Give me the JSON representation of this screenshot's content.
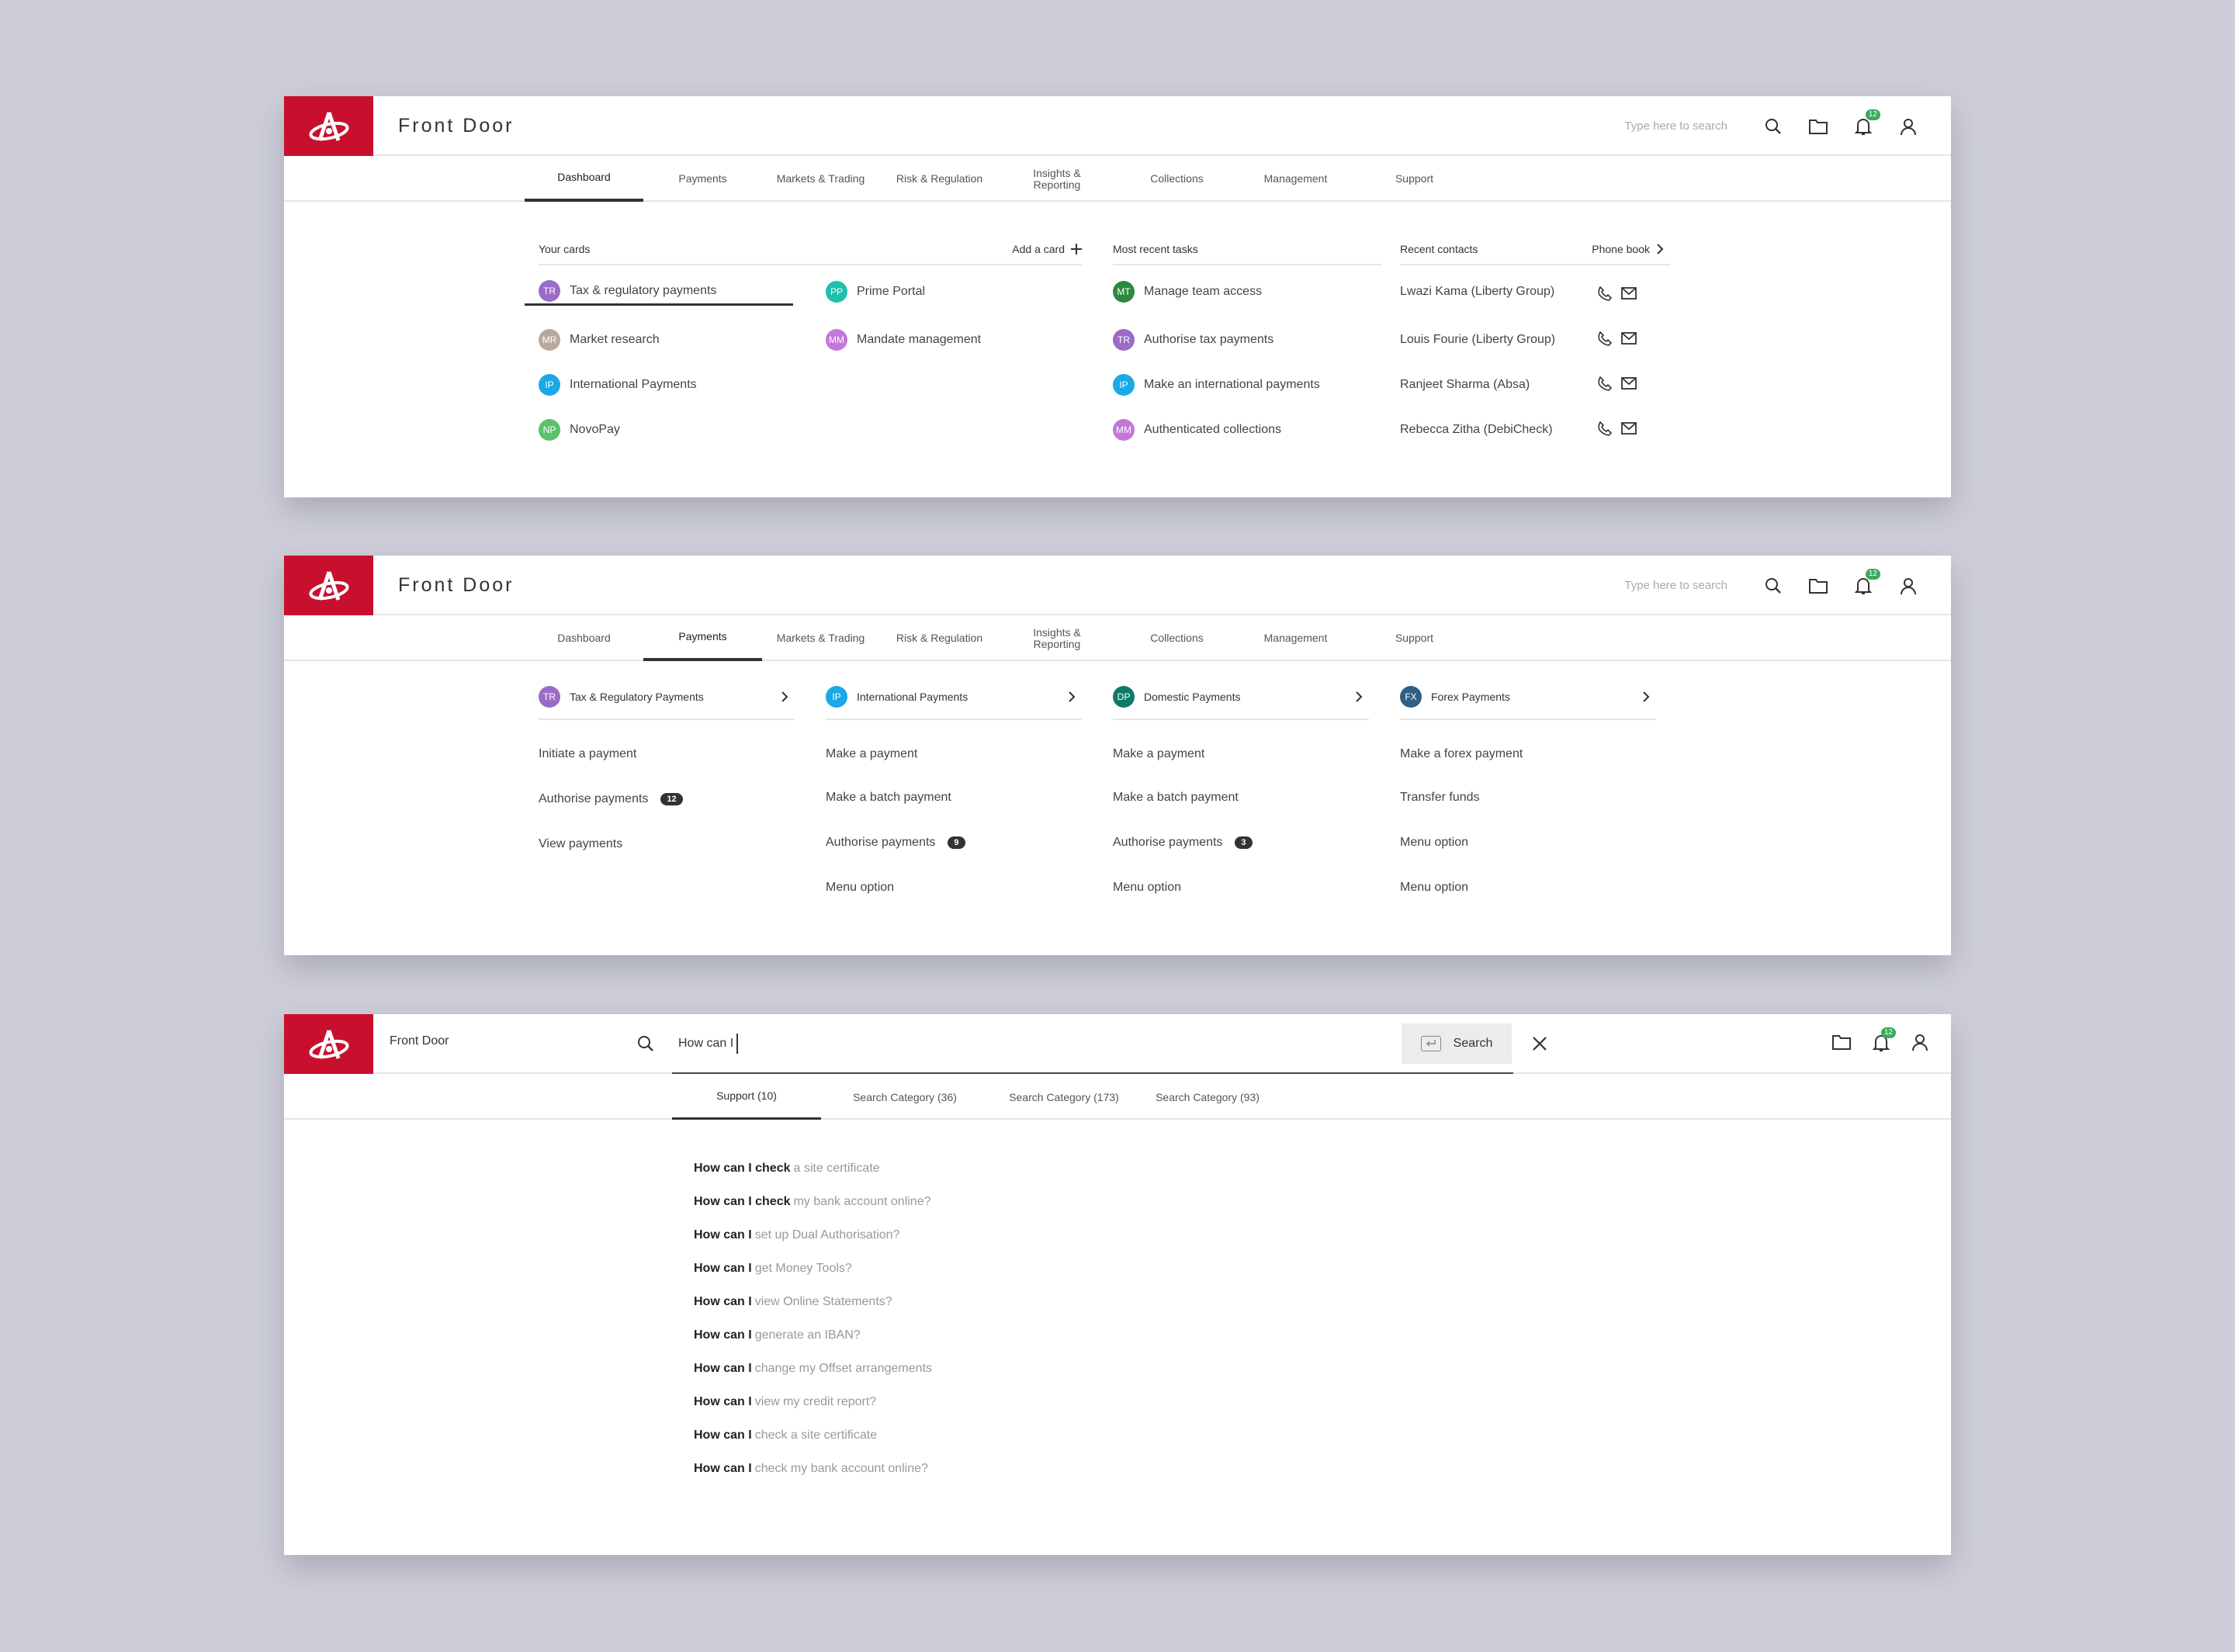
{
  "brand": {
    "title": "Front Door",
    "accent": "#c8102e"
  },
  "header": {
    "search_placeholder": "Type here to search",
    "notifications_count": "12"
  },
  "nav": {
    "tabs": [
      "Dashboard",
      "Payments",
      "Markets & Trading",
      "Risk & Regulation",
      "Insights & Reporting",
      "Collections",
      "Management",
      "Support"
    ]
  },
  "dashboard": {
    "cards": {
      "heading": "Your cards",
      "add_label": "Add a card",
      "items": [
        {
          "initials": "TR",
          "label": "Tax & regulatory payments",
          "color": "#9b6cc6"
        },
        {
          "initials": "PP",
          "label": "Prime Portal",
          "color": "#1fbfae"
        },
        {
          "initials": "MR",
          "label": "Market research",
          "color": "#b7a89a"
        },
        {
          "initials": "MM",
          "label": "Mandate management",
          "color": "#c178d8"
        },
        {
          "initials": "IP",
          "label": "International Payments",
          "color": "#1aa8e6"
        },
        {
          "initials": "NP",
          "label": "NovoPay",
          "color": "#5cc16c"
        }
      ]
    },
    "tasks": {
      "heading": "Most recent tasks",
      "items": [
        {
          "initials": "MT",
          "label": "Manage team access",
          "color": "#2c8a3e"
        },
        {
          "initials": "TR",
          "label": "Authorise tax payments",
          "color": "#9b6cc6"
        },
        {
          "initials": "IP",
          "label": "Make an international payments",
          "color": "#1aa8e6"
        },
        {
          "initials": "MM",
          "label": "Authenticated collections",
          "color": "#c178d8"
        }
      ]
    },
    "contacts": {
      "heading": "Recent contacts",
      "phonebook_label": "Phone book",
      "items": [
        "Lwazi Kama (Liberty Group)",
        "Louis Fourie (Liberty Group)",
        "Ranjeet Sharma (Absa)",
        "Rebecca Zitha (DebiCheck)"
      ]
    }
  },
  "payments": {
    "columns": [
      {
        "initials": "TR",
        "title": "Tax & Regulatory Payments",
        "color": "#9b6cc6",
        "items": [
          {
            "label": "Initiate a payment",
            "badge": ""
          },
          {
            "label": "Authorise payments",
            "badge": "12"
          },
          {
            "label": "View payments",
            "badge": ""
          }
        ]
      },
      {
        "initials": "IP",
        "title": "International Payments",
        "color": "#1aa8e6",
        "items": [
          {
            "label": "Make a payment",
            "badge": ""
          },
          {
            "label": "Make a batch payment",
            "badge": ""
          },
          {
            "label": "Authorise payments",
            "badge": "9"
          },
          {
            "label": "Menu option",
            "badge": ""
          }
        ]
      },
      {
        "initials": "DP",
        "title": "Domestic Payments",
        "color": "#0f7a6a",
        "items": [
          {
            "label": "Make a payment",
            "badge": ""
          },
          {
            "label": "Make a batch payment",
            "badge": ""
          },
          {
            "label": "Authorise payments",
            "badge": "3"
          },
          {
            "label": "Menu option",
            "badge": ""
          }
        ]
      },
      {
        "initials": "FX",
        "title": "Forex Payments",
        "color": "#2f5f86",
        "items": [
          {
            "label": "Make a forex payment",
            "badge": ""
          },
          {
            "label": "Transfer funds",
            "badge": ""
          },
          {
            "label": "Menu option",
            "badge": ""
          },
          {
            "label": "Menu option",
            "badge": ""
          }
        ]
      }
    ]
  },
  "search": {
    "query": "How can I",
    "button_label": "Search",
    "tabs": [
      "Support  (10)",
      "Search Category (36)",
      "Search Category (173)",
      "Search Category (93)"
    ],
    "suggestions": [
      {
        "bold": "How can I check",
        "rest": "a site certificate"
      },
      {
        "bold": "How can I check",
        "rest": "my bank account online?"
      },
      {
        "bold": "How can I",
        "rest": "set up Dual Authorisation?"
      },
      {
        "bold": "How can I",
        "rest": "get Money Tools?"
      },
      {
        "bold": "How can I",
        "rest": "view Online Statements?"
      },
      {
        "bold": "How can I",
        "rest": "generate an IBAN?"
      },
      {
        "bold": "How can I",
        "rest": "change my Offset arrangements"
      },
      {
        "bold": "How can I",
        "rest": "view my credit report?"
      },
      {
        "bold": "How can I",
        "rest": "check a site certificate"
      },
      {
        "bold": "How can I",
        "rest": "check my bank account online?"
      }
    ]
  }
}
